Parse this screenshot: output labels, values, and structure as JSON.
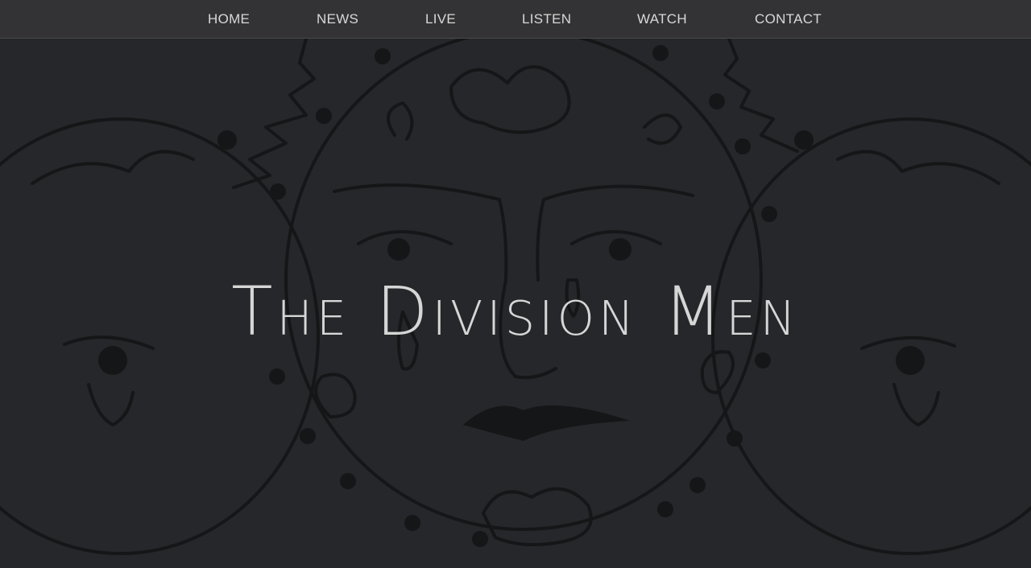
{
  "nav": {
    "items": [
      {
        "label": "HOME"
      },
      {
        "label": "NEWS"
      },
      {
        "label": "LIVE"
      },
      {
        "label": "LISTEN"
      },
      {
        "label": "WATCH"
      },
      {
        "label": "CONTACT"
      }
    ]
  },
  "hero": {
    "title": "The Division Men",
    "background_art": "sun-face-illustration"
  },
  "colors": {
    "nav_background": "#333335",
    "page_background": "#25272a",
    "line_art": "#141617",
    "text": "#d6d6d6"
  }
}
